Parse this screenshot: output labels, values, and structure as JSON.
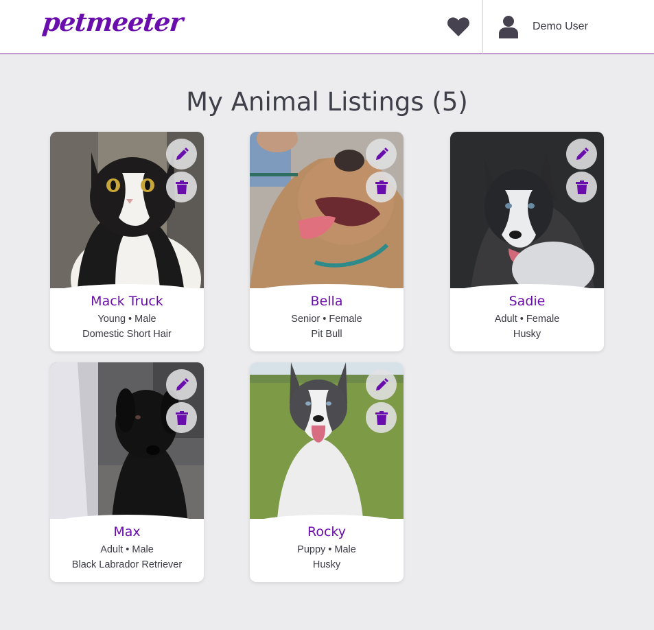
{
  "brand": {
    "logo_text": "petmeeter",
    "accent": "#6a0dad"
  },
  "header": {
    "favorites_icon": "heart-icon",
    "user": {
      "icon": "user-icon",
      "name": "Demo User"
    }
  },
  "page": {
    "title": "My Animal Listings (5)"
  },
  "listings": [
    {
      "name": "Mack Truck",
      "age": "Young",
      "gender": "Male",
      "meta": "Young • Male",
      "breed": "Domestic Short Hair"
    },
    {
      "name": "Bella",
      "age": "Senior",
      "gender": "Female",
      "meta": "Senior • Female",
      "breed": "Pit Bull"
    },
    {
      "name": "Sadie",
      "age": "Adult",
      "gender": "Female",
      "meta": "Adult • Female",
      "breed": "Husky"
    },
    {
      "name": "Max",
      "age": "Adult",
      "gender": "Male",
      "meta": "Adult • Male",
      "breed": "Black Labrador Retriever"
    },
    {
      "name": "Rocky",
      "age": "Puppy",
      "gender": "Male",
      "meta": "Puppy • Male",
      "breed": "Husky"
    }
  ],
  "card_actions": {
    "edit_icon": "pencil-icon",
    "delete_icon": "trash-icon"
  }
}
